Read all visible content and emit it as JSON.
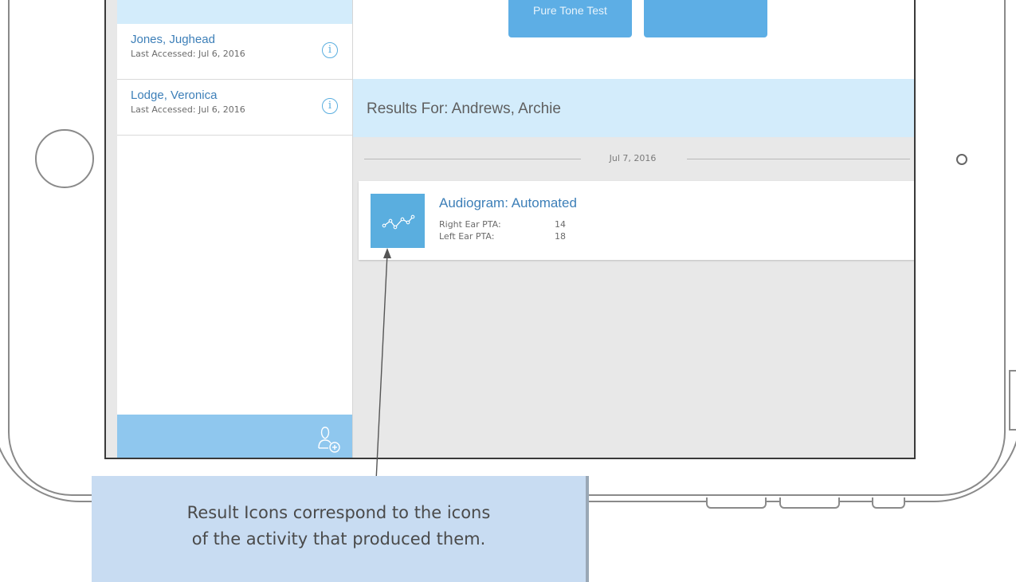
{
  "activity_buttons": [
    {
      "label": "Pure Tone Test"
    },
    {
      "label": ""
    }
  ],
  "patients": [
    {
      "name": "Jones, Jughead",
      "last_accessed": "Last Accessed: Jul 6, 2016",
      "info_icon": "info-icon"
    },
    {
      "name": "Lodge, Veronica",
      "last_accessed": "Last Accessed: Jul 6, 2016",
      "info_icon": "info-icon"
    }
  ],
  "sidebar_footer": {
    "icon": "add-user-icon"
  },
  "results": {
    "header": "Results For: Andrews, Archie",
    "date": "Jul 7, 2016",
    "cards": [
      {
        "icon": "audiogram-icon",
        "title": "Audiogram: Automated",
        "right_label": "Right Ear PTA:",
        "right_value": "14",
        "left_label": "Left Ear PTA:",
        "left_value": "18"
      }
    ]
  },
  "annotation": {
    "line1": "Result Icons correspond to the icons",
    "line2": "of the activity that produced them."
  },
  "colors": {
    "accent": "#5aaedf",
    "header_bg": "#d3ecfb",
    "sidebar_footer": "#8fc7ee",
    "callout_bg": "#c8dcf2"
  }
}
